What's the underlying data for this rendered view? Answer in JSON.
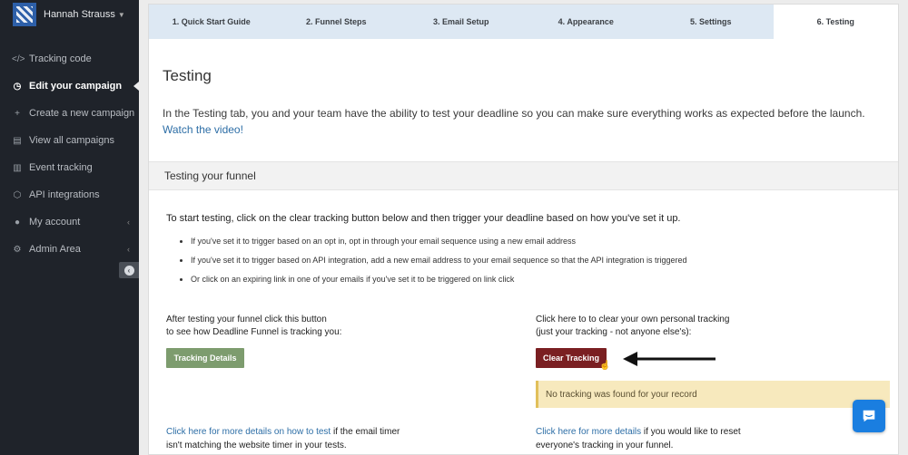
{
  "sidebar": {
    "user_name": "Hannah Strauss",
    "items": [
      {
        "label": "Tracking code",
        "icon": "code-icon",
        "glyph": "</>"
      },
      {
        "label": "Edit your campaign",
        "icon": "clock-icon",
        "glyph": "◷"
      },
      {
        "label": "Create a new campaign",
        "icon": "plus-icon",
        "glyph": "+"
      },
      {
        "label": "View all campaigns",
        "icon": "list-icon",
        "glyph": "▤"
      },
      {
        "label": "Event tracking",
        "icon": "bar-chart-icon",
        "glyph": "▥"
      },
      {
        "label": "API integrations",
        "icon": "cube-icon",
        "glyph": "⬡"
      },
      {
        "label": "My account",
        "icon": "user-icon",
        "glyph": "●"
      },
      {
        "label": "Admin Area",
        "icon": "gears-icon",
        "glyph": "⚙"
      }
    ]
  },
  "tabs": [
    "1. Quick Start Guide",
    "2. Funnel Steps",
    "3. Email Setup",
    "4. Appearance",
    "5. Settings",
    "6. Testing"
  ],
  "page": {
    "title": "Testing",
    "intro_text": "In the Testing tab, you and your team have the ability to test your deadline so you can make sure everything works as expected before the launch.",
    "intro_link": "Watch the video!",
    "section_title": "Testing your funnel",
    "lead": "To start testing, click on the clear tracking button below and then trigger your deadline based on how you've set it up.",
    "bullets": [
      "If you've set it to trigger based on an opt in, opt in through your email sequence using a new email address",
      "If you've set it to trigger based on API integration, add a new email address to your email sequence so that the API integration is triggered",
      "Or click on an expiring link in one of your emails if you've set it to be triggered on link click"
    ],
    "left_text_1": "After testing your funnel click this button",
    "left_text_2": "to see how Deadline Funnel is tracking you:",
    "left_button": "Tracking Details",
    "right_text_1": "Click here to to clear your own personal tracking",
    "right_text_2": "(just your tracking - not anyone else's):",
    "right_button": "Clear Tracking",
    "notice": "No tracking was found for your record",
    "left_foot_link": "Click here for more details on how to test",
    "left_foot_text_a": " if the email timer",
    "left_foot_text_b": "isn't matching the website timer in your tests.",
    "right_foot_link": "Click here for more details",
    "right_foot_text_a": " if you would like to reset",
    "right_foot_text_b": "everyone's tracking in your funnel."
  },
  "colors": {
    "sidebar_bg": "#1f232a",
    "tab_bg": "#dde8f3",
    "link": "#2d6ea6",
    "green_button": "#7d9c6e",
    "red_button": "#7a1f22",
    "notice_bg": "#f7e9bd",
    "chat_button": "#1a7ee0"
  }
}
